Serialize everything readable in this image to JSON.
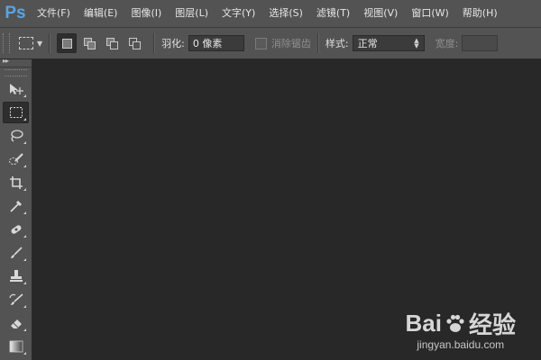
{
  "app": {
    "logo": "Ps"
  },
  "menu": {
    "items": [
      "文件(F)",
      "编辑(E)",
      "图像(I)",
      "图层(L)",
      "文字(Y)",
      "选择(S)",
      "滤镜(T)",
      "视图(V)",
      "窗口(W)",
      "帮助(H)"
    ]
  },
  "options": {
    "feather_label": "羽化:",
    "feather_value": "0 像素",
    "antialias_label": "消除锯齿",
    "style_label": "样式:",
    "style_value": "正常",
    "width_label": "宽度:"
  },
  "toolbar": {
    "collapse": "▸▸",
    "tools": [
      "move-tool",
      "rectangular-marquee-tool",
      "lasso-tool",
      "quick-selection-tool",
      "crop-tool",
      "eyedropper-tool",
      "spot-healing-tool",
      "brush-tool",
      "clone-stamp-tool",
      "history-brush-tool",
      "eraser-tool",
      "gradient-tool"
    ]
  },
  "watermark": {
    "brand_left": "Bai",
    "brand_right": "经验",
    "site": "jingyan.baidu.com"
  },
  "colors": {
    "chrome": "#535353",
    "workspace": "#282828",
    "ps_logo": "#59a3e6"
  }
}
